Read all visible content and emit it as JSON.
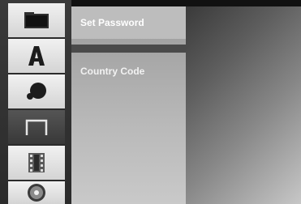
{
  "sidebar": {
    "items": [
      {
        "icon": "folder-icon",
        "active": false
      },
      {
        "icon": "language-letter-a-icon",
        "active": false
      },
      {
        "icon": "audio-speaker-icon",
        "active": false
      },
      {
        "icon": "lock-icon",
        "active": true
      },
      {
        "icon": "film-strip-icon",
        "active": false
      },
      {
        "icon": "disc-icon",
        "active": false
      }
    ]
  },
  "menu": {
    "items": [
      {
        "label": "Set Password",
        "selected": true
      },
      {
        "label": "Country Code",
        "selected": false
      }
    ]
  }
}
